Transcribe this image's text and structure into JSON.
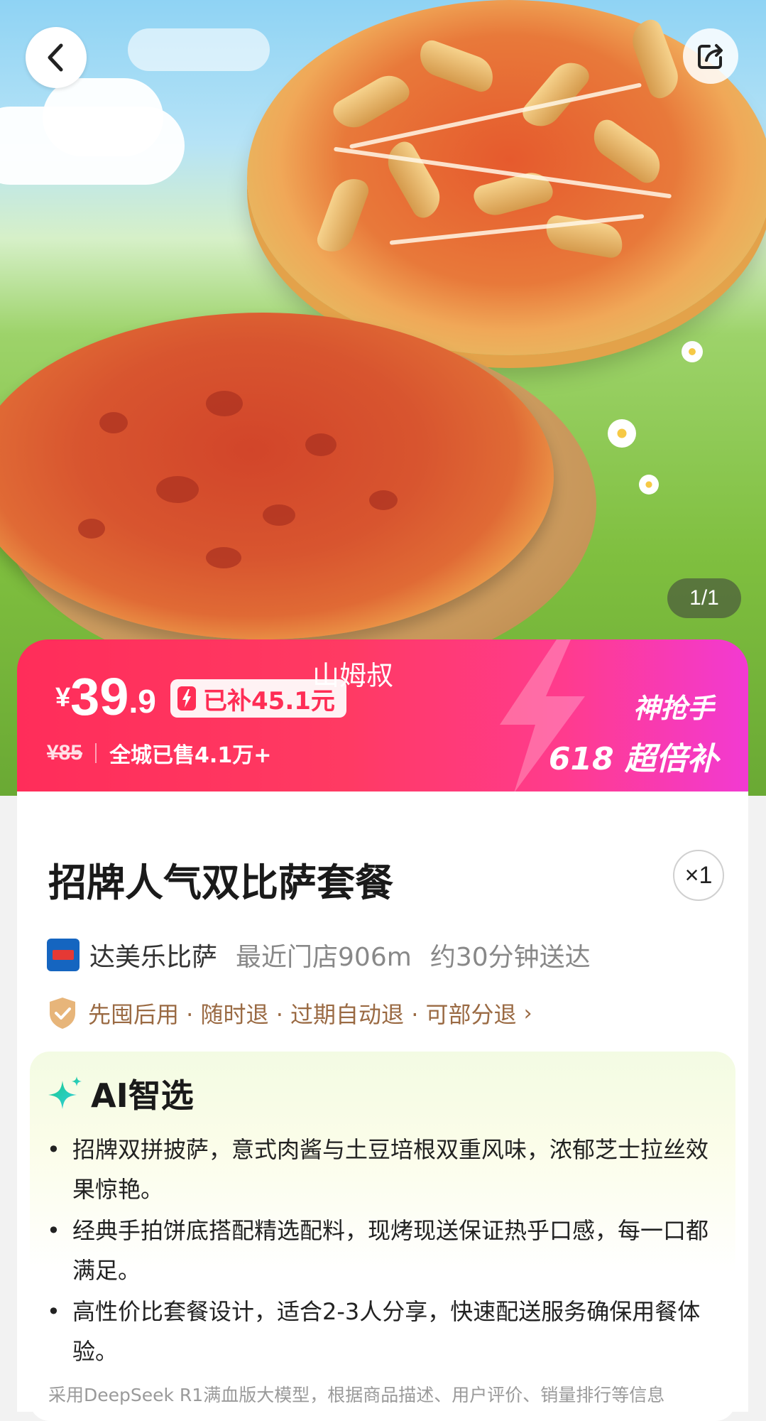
{
  "hero": {
    "pager": "1/1"
  },
  "watermark": "山姆叔",
  "price": {
    "currency": "¥",
    "integer": "39",
    "decimal": ".9",
    "subsidy_label": "已补45.1元",
    "original_price": "¥85",
    "sold_text": "全城已售4.1万+",
    "promo_line1": "神抢手",
    "promo_line2": "618 超倍补"
  },
  "product": {
    "title": "招牌人气双比萨套餐",
    "quantity": "×1"
  },
  "store": {
    "name": "达美乐比萨",
    "distance": "最近门店906m",
    "delivery": "约30分钟送达"
  },
  "guarantee": {
    "text": "先囤后用 · 随时退 · 过期自动退 · 可部分退"
  },
  "ai": {
    "title": "AI智选",
    "bullets": [
      "招牌双拼披萨，意式肉酱与土豆培根双重风味，浓郁芝士拉丝效果惊艳。",
      "经典手拍饼底搭配精选配料，现烤现送保证热乎口感，每一口都满足。",
      "高性价比套餐设计，适合2-3人分享，快速配送服务确保用餐体验。"
    ],
    "disclaimer": "采用DeepSeek R1满血版大模型，根据商品描述、用户评价、销量排行等信息"
  },
  "colors": {
    "banner_start": "#ff2d5a",
    "banner_end": "#f23ad2",
    "subsidy_text": "#ff2d55",
    "guarantee_text": "#9a6a43",
    "ai_star_start": "#18c98a",
    "ai_star_end": "#35d0e0"
  },
  "icons": [
    "back-arrow-icon",
    "share-icon",
    "bolt-icon",
    "store-logo-icon",
    "shield-check-icon",
    "chevron-right-icon",
    "sparkle-icon"
  ]
}
